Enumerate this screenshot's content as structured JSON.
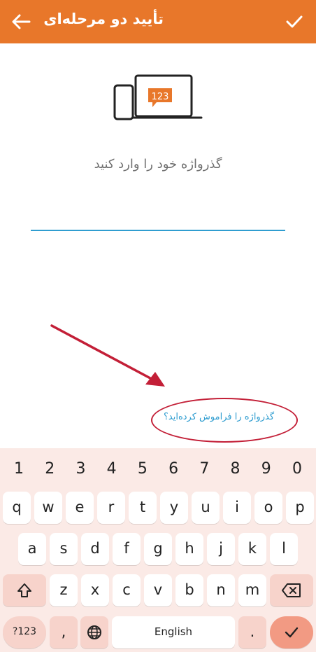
{
  "header": {
    "title": "تأیید دو مرحله‌ای",
    "back_icon": "arrow-left-icon",
    "confirm_icon": "check-icon",
    "bg_color": "#E8772A"
  },
  "illustration": {
    "code": "123"
  },
  "prompt": "گذرواژه خود را وارد کنید",
  "password": {
    "value": "",
    "placeholder": ""
  },
  "forgot_link": "گذرواژه را فراموش کرده‌اید؟",
  "accent_color": "#2F9DD0",
  "keyboard": {
    "numbers": [
      "1",
      "2",
      "3",
      "4",
      "5",
      "6",
      "7",
      "8",
      "9",
      "0"
    ],
    "row1": [
      "q",
      "w",
      "e",
      "r",
      "t",
      "y",
      "u",
      "i",
      "o",
      "p"
    ],
    "row2": [
      "a",
      "s",
      "d",
      "f",
      "g",
      "h",
      "j",
      "k",
      "l"
    ],
    "row3": [
      "z",
      "x",
      "c",
      "v",
      "b",
      "n",
      "m"
    ],
    "symbols_label": "?123",
    "comma": ",",
    "space_label": "English",
    "period": ".",
    "shift_icon": "shift-icon",
    "backspace_icon": "backspace-icon",
    "globe_icon": "globe-icon",
    "enter_icon": "check-icon"
  }
}
